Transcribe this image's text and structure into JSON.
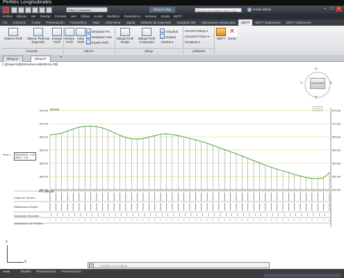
{
  "top_title": "Perfiles Longitudinales",
  "title_bar": {
    "workspace": "Dibujo y anotación",
    "file": "Dibujo2.dwg",
    "search_placeholder": "Escriba una palabra clave o una frase",
    "signin": "Iniciar sesión"
  },
  "menu": [
    "Archivo",
    "Edición",
    "Ver",
    "Insertar",
    "Formato",
    "Herr",
    "Dibujo",
    "Acotar",
    "Modificar",
    "Paramétrico",
    "Ventana",
    "Ayuda",
    "MDT7"
  ],
  "ribbon_tabs": [
    "Inic",
    "Inserción",
    "Anotar",
    "Presentación",
    "Paramétrico",
    "Vista",
    "Administrar",
    "Salida",
    "Módulos de extensión",
    "Autodesk 360",
    "Aplicaciones destacadas",
    "MDT7",
    "MDT7-Segmentos",
    "MDT7-Volúmenes"
  ],
  "ribbon": {
    "obtener_perfil": "Obtener Perfil",
    "obtener_regresion": "Obtener Perfil por Regresión",
    "entrada_perfil": "Entrada Perfil",
    "revisar_perfil": "Revisar Perfil",
    "listar_perfil": "Listar Perfil",
    "desplazar_pk": "Desplazar P.K.",
    "desplazar_cota": "Desplazar Cota",
    "invertir_perfil": "Invertir Perfil",
    "dibujar_simple": "Dibujar Perfil Simple",
    "dibujar_compuesto": "Dibujar Perfil Compuesto",
    "actualizar": "Actualizar",
    "guitarra": "Guitarra",
    "insertar": "Insertar",
    "convertir_dibujo": "Convertir Dibujo",
    "convertir_fichero": "Convertir Fichero",
    "comparar": "Comparar",
    "mdt7": "MDT7",
    "cerrar": "Cerrar",
    "group_creacion": "Creación",
    "group_edicion": "Edición",
    "group_dibujo": "Dibujo",
    "group_utilidades": "Utilidades"
  },
  "doc_tabs": [
    "Dibujo1*",
    "Dibujo2*"
  ],
  "viewport_label": "[−][Superior][Estructura alámbrica 2D]",
  "viewcube": {
    "face": "SUPERIOR",
    "n": "N",
    "s": "S",
    "e": "E",
    "o": "O",
    "wcs": "SCU"
  },
  "guitarra_labels": [
    "Cotas de Terreno",
    "Distancias a Origen",
    "Distancias Parciales",
    "Numeración de Perfiles"
  ],
  "pc_label": "P.C. 545,00",
  "profile_name": "Perfil 1",
  "profile_info": [
    "PENDIENTE = 1.00",
    "ÁREA = 1.00"
  ],
  "command_placeholder": "Escriba un comando",
  "layout_tabs": [
    "Modelo",
    "Presentación1",
    "Presentación2"
  ],
  "colors": {
    "terrain": "#3a9a3a",
    "grid": "#d8d25a",
    "guide": "#555555"
  },
  "chart_data": {
    "type": "line",
    "title": "",
    "xlabel": "",
    "ylabel": "",
    "y_ticks": [
      "575,00",
      "570,00",
      "565,00",
      "560,00",
      "555,00",
      "550,00",
      "545,00"
    ],
    "ylim": [
      545,
      575
    ],
    "ref_label": "terreno",
    "x": [
      0,
      10,
      20,
      30,
      40,
      50,
      60,
      70,
      80,
      90,
      100,
      110,
      120,
      130,
      140,
      150,
      160,
      170,
      180,
      190,
      200,
      210,
      220,
      230,
      240,
      250,
      260,
      270,
      280,
      290,
      300,
      310,
      320,
      330,
      340,
      350,
      360,
      370,
      380,
      390,
      400,
      410,
      420,
      430,
      440,
      450,
      460,
      470,
      480
    ],
    "series": [
      {
        "values": [
          565.8,
          566.0,
          566.4,
          567.2,
          568.0,
          568.7,
          569.0,
          569.1,
          568.9,
          568.4,
          567.6,
          566.6,
          565.6,
          564.8,
          564.3,
          564.2,
          564.4,
          564.9,
          565.5,
          566.0,
          566.2,
          565.9,
          565.5,
          565.0,
          564.4,
          563.9,
          563.3,
          562.6,
          561.8,
          561.0,
          560.2,
          559.4,
          558.6,
          557.8,
          556.9,
          556.0,
          555.2,
          554.3,
          553.5,
          552.8,
          552.1,
          551.5,
          550.8,
          550.2,
          549.6,
          549.3,
          549.2,
          549.5,
          551.5
        ]
      }
    ]
  }
}
